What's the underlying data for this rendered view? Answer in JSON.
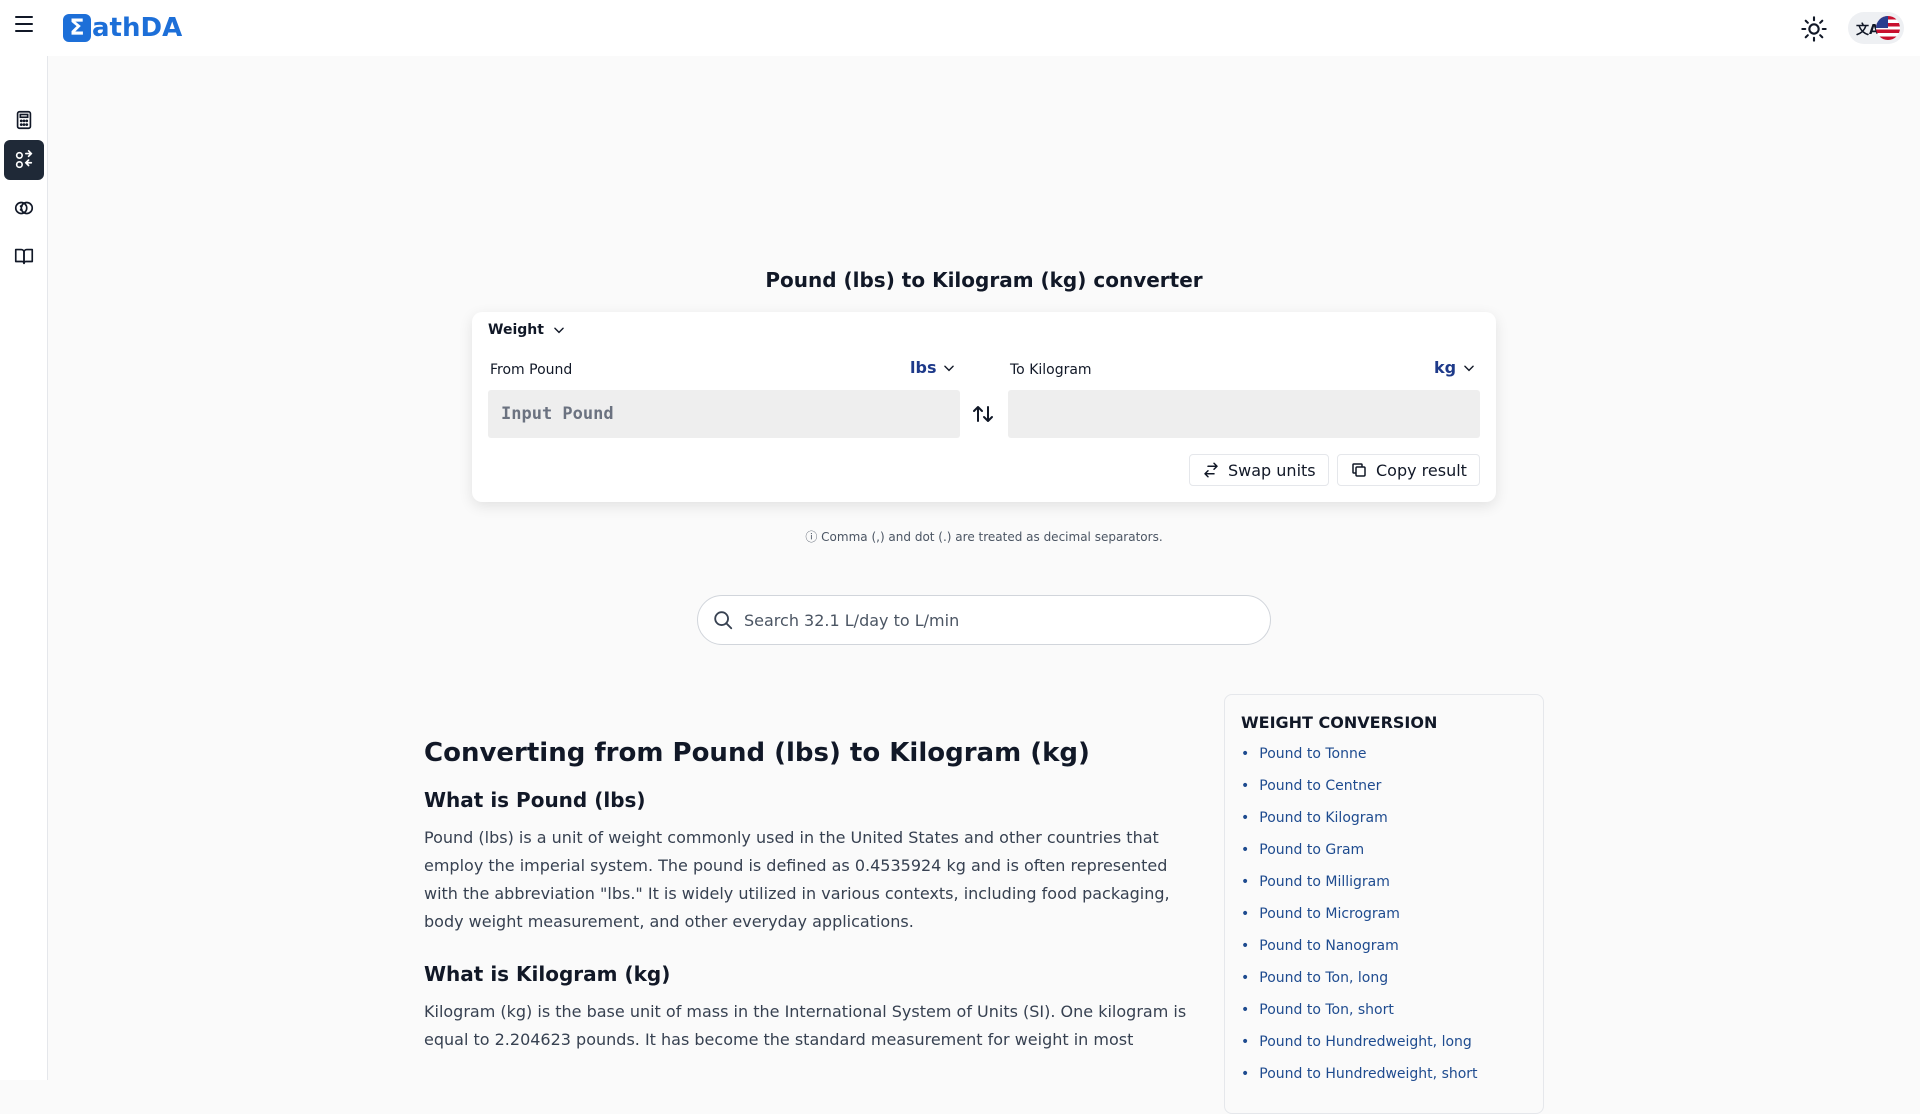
{
  "app": {
    "logo_text": "athDA",
    "logo_mark": "Σ"
  },
  "header": {
    "theme_icon": "sun-icon",
    "language_icon": "translate-icon",
    "language_flag": "us-flag-icon"
  },
  "sidebar": {
    "items": [
      {
        "name": "calculator",
        "icon": "calculator-icon",
        "active": false
      },
      {
        "name": "converter",
        "icon": "converter-icon",
        "active": true
      },
      {
        "name": "currency",
        "icon": "currency-icon",
        "active": false
      },
      {
        "name": "library",
        "icon": "book-icon",
        "active": false
      }
    ]
  },
  "converter": {
    "title": "Pound (lbs) to Kilogram (kg) converter",
    "category": "Weight",
    "from_label": "From Pound",
    "from_unit": "lbs",
    "from_placeholder": "Input Pound",
    "from_value": "",
    "to_label": "To Kilogram",
    "to_unit": "kg",
    "to_value": "",
    "swap_label": "Swap units",
    "copy_label": "Copy result",
    "note": "ⓘ Comma (,) and dot (.) are treated as decimal separators."
  },
  "search": {
    "placeholder": "Search 32.1 L/day to L/min"
  },
  "article": {
    "heading": "Converting from Pound (lbs) to Kilogram (kg)",
    "section1_title": "What is Pound (lbs)",
    "section1_text": "Pound (lbs) is a unit of weight commonly used in the United States and other countries that employ the imperial system. The pound is defined as 0.4535924 kg and is often represented with the abbreviation \"lbs.\" It is widely utilized in various contexts, including food packaging, body weight measurement, and other everyday applications.",
    "section2_title": "What is Kilogram (kg)",
    "section2_text": "Kilogram (kg) is the base unit of mass in the International System of Units (SI). One kilogram is equal to 2.204623 pounds. It has become the standard measurement for weight in most"
  },
  "related": {
    "title": "WEIGHT CONVERSION",
    "links": [
      "Pound to Tonne",
      "Pound to Centner",
      "Pound to Kilogram",
      "Pound to Gram",
      "Pound to Milligram",
      "Pound to Microgram",
      "Pound to Nanogram",
      "Pound to Ton, long",
      "Pound to Ton, short",
      "Pound to Hundredweight, long",
      "Pound to Hundredweight, short"
    ]
  },
  "colors": {
    "brand": "#1d6fd8",
    "link": "#1e4b8f",
    "unit_accent": "#1e3a8a",
    "sidebar_active": "#1f2937"
  }
}
